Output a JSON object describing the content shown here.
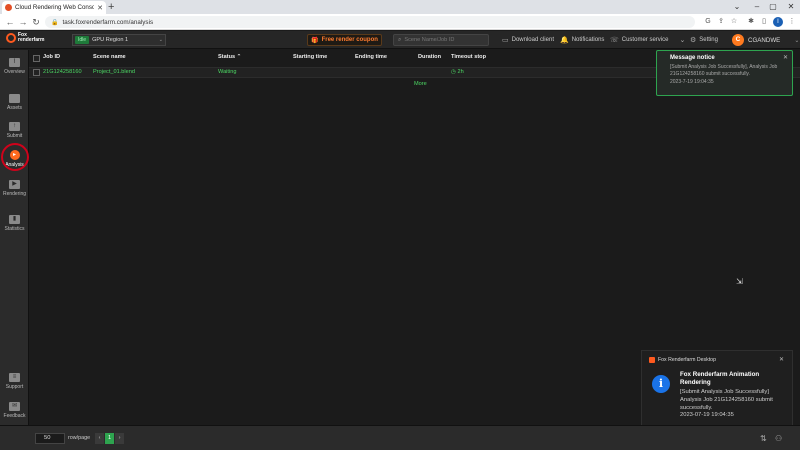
{
  "browser": {
    "tab_title": "Cloud Rendering Web Console -",
    "url": "task.foxrenderfarm.com/analysis"
  },
  "header": {
    "logo_line1": "Fox",
    "logo_line2": "renderfarm",
    "region_badge": "Idle",
    "region_name": "GPU Region 1",
    "coupon": "Free render coupon",
    "search_placeholder": "Scene Name/Job ID",
    "download_client": "Download client",
    "notifications": "Notifications",
    "customer_service": "Customer service",
    "setting": "Setting",
    "user_initial": "C",
    "user_name": "CGANDWE"
  },
  "sidebar": {
    "items": [
      {
        "label": "Overview"
      },
      {
        "label": "Assets"
      },
      {
        "label": "Submit"
      },
      {
        "label": "Analysis"
      },
      {
        "label": "Rendering"
      },
      {
        "label": "Statistics"
      },
      {
        "label": "Support"
      },
      {
        "label": "Feedback"
      }
    ]
  },
  "table": {
    "headers": [
      "Job ID",
      "Scene name",
      "Status",
      "Starting time",
      "Ending time",
      "Duration",
      "Timeout stop"
    ],
    "rows": [
      {
        "job_id": "21G124258160",
        "scene": "Project_01.blend",
        "status": "Waiting",
        "start": "",
        "end": "",
        "duration": "",
        "timeout": "2h"
      }
    ],
    "more": "More"
  },
  "notice": {
    "title": "Message notice",
    "body": "[Submit Analysis Job Successfully], Analysis Job 21G124258160 submit successfully.",
    "date": "2023-7-19 19:04:35"
  },
  "toast": {
    "app": "Fox Renderfarm Desktop",
    "title": "Fox Renderfarm Animation Rendering",
    "body": "[Submit Analysis Job Successfully] Analysis Job 21G124258160 submit successfully.",
    "time": "2023-07-19 19:04:35"
  },
  "pagination": {
    "rows_per_page": "50",
    "rows_label": "row/page",
    "prev": "‹",
    "current": "1",
    "next": "›"
  }
}
